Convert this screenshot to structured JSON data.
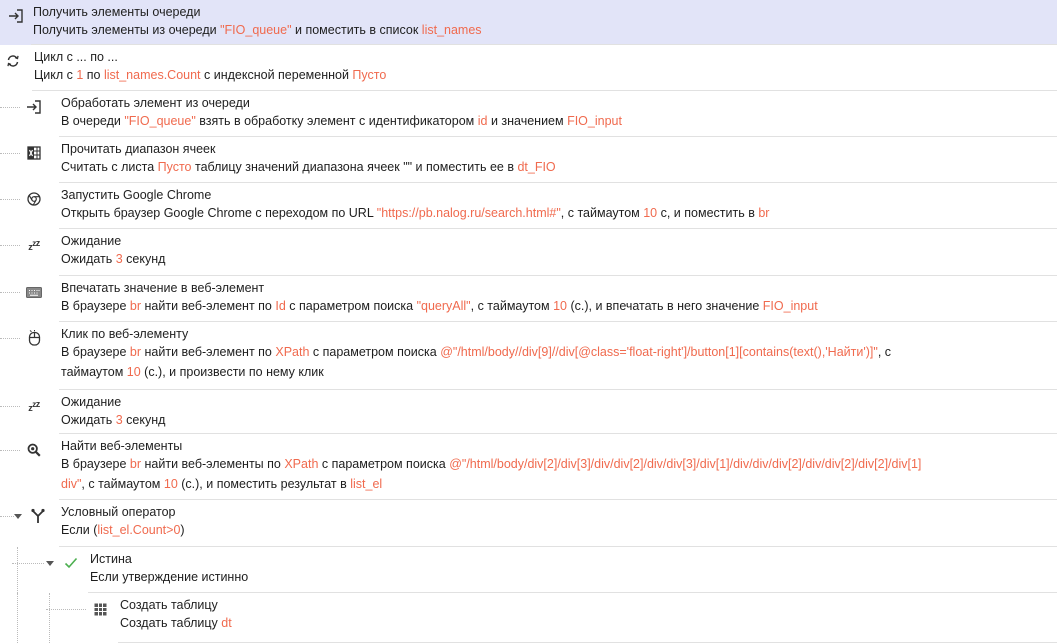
{
  "colors": {
    "accent_variable": "#f06a4e",
    "selected_row": "#e2e4f8",
    "text": "#1e1e1e"
  },
  "steps": [
    {
      "icon": "arrow-into-bracket-icon",
      "title": "Получить элементы очереди",
      "parts": [
        {
          "t": "Получить элементы из очереди "
        },
        {
          "t": "\"FIO_queue\"",
          "v": true
        },
        {
          "t": " и поместить в список "
        },
        {
          "t": "list_names",
          "v": true
        }
      ]
    },
    {
      "icon": "loop-arrows-icon",
      "title": "Цикл с ... по ...",
      "parts": [
        {
          "t": "Цикл с "
        },
        {
          "t": "1",
          "v": true
        },
        {
          "t": " по "
        },
        {
          "t": "list_names.Count",
          "v": true
        },
        {
          "t": " с индексной переменной "
        },
        {
          "t": "Пусто",
          "v": true
        }
      ]
    },
    {
      "icon": "arrow-into-bracket-icon",
      "title": "Обработать элемент из очереди",
      "parts": [
        {
          "t": "В очереди "
        },
        {
          "t": "\"FIO_queue\"",
          "v": true
        },
        {
          "t": " взять в обработку элемент с идентификатором "
        },
        {
          "t": "id",
          "v": true
        },
        {
          "t": " и значением "
        },
        {
          "t": "FIO_input",
          "v": true
        }
      ]
    },
    {
      "icon": "excel-sheet-icon",
      "title": "Прочитать диапазон ячеек",
      "parts": [
        {
          "t": "Считать с листа "
        },
        {
          "t": "Пусто",
          "v": true
        },
        {
          "t": " таблицу значений диапазона ячеек \"\" и поместить ее в "
        },
        {
          "t": "dt_FIO",
          "v": true
        }
      ]
    },
    {
      "icon": "chrome-logo-icon",
      "title": "Запустить Google Chrome",
      "parts": [
        {
          "t": "Открыть браузер Google Chrome с переходом по URL "
        },
        {
          "t": "\"https://pb.nalog.ru/search.html#\"",
          "v": true
        },
        {
          "t": ", с таймаутом "
        },
        {
          "t": "10",
          "v": true
        },
        {
          "t": " с, и поместить в "
        },
        {
          "t": "br",
          "v": true
        }
      ]
    },
    {
      "icon": "sleep-zzz-icon",
      "title": "Ожидание",
      "parts": [
        {
          "t": "Ожидать "
        },
        {
          "t": "3",
          "v": true
        },
        {
          "t": " секунд"
        }
      ]
    },
    {
      "icon": "keyboard-icon",
      "title": "Впечатать значение в веб-элемент",
      "parts": [
        {
          "t": "В браузере "
        },
        {
          "t": "br",
          "v": true
        },
        {
          "t": " найти веб-элемент по "
        },
        {
          "t": "Id",
          "v": true
        },
        {
          "t": " с параметром поиска "
        },
        {
          "t": "\"queryAll\"",
          "v": true
        },
        {
          "t": ", с таймаутом "
        },
        {
          "t": "10",
          "v": true
        },
        {
          "t": " (с.), и впечатать в него значение "
        },
        {
          "t": "FIO_input",
          "v": true
        }
      ]
    },
    {
      "icon": "mouse-click-icon",
      "title": "Клик по веб-элементу",
      "parts": [
        {
          "t": "В браузере "
        },
        {
          "t": "br",
          "v": true
        },
        {
          "t": " найти веб-элемент по "
        },
        {
          "t": "XPath",
          "v": true
        },
        {
          "t": " с параметром поиска "
        },
        {
          "t": "@\"/html/body//div[9]//div[@class='float-right']/button[1][contains(text(),'Найти')]\"",
          "v": true
        },
        {
          "t": ", с"
        }
      ],
      "parts2": [
        {
          "t": "таймаутом "
        },
        {
          "t": "10",
          "v": true
        },
        {
          "t": " (с.), и произвести по нему клик"
        }
      ]
    },
    {
      "icon": "sleep-zzz-icon",
      "title": "Ожидание",
      "parts": [
        {
          "t": "Ожидать "
        },
        {
          "t": "3",
          "v": true
        },
        {
          "t": " секунд"
        }
      ]
    },
    {
      "icon": "search-element-icon",
      "title": "Найти веб-элементы",
      "parts": [
        {
          "t": "В браузере "
        },
        {
          "t": "br",
          "v": true
        },
        {
          "t": " найти веб-элементы по "
        },
        {
          "t": "XPath",
          "v": true
        },
        {
          "t": " с параметром поиска "
        },
        {
          "t": "@\"/html/body/div[2]/div[3]/div/div[2]/div/div[3]/div[1]/div/div/div[2]/div/div[2]/div[2]/div[1]",
          "v": true
        }
      ],
      "parts2": [
        {
          "t": "div\"",
          "v": true
        },
        {
          "t": ", с таймаутом "
        },
        {
          "t": "10",
          "v": true
        },
        {
          "t": " (с.), и поместить результат в "
        },
        {
          "t": "list_el",
          "v": true
        }
      ]
    },
    {
      "icon": "branch-fork-icon",
      "title": "Условный оператор",
      "parts": [
        {
          "t": "Если ("
        },
        {
          "t": "list_el.Count>0",
          "v": true
        },
        {
          "t": ")"
        }
      ]
    },
    {
      "icon": "checkmark-icon",
      "title": "Истина",
      "parts": [
        {
          "t": "Если утверждение истинно"
        }
      ]
    },
    {
      "icon": "table-grid-icon",
      "title": "Создать таблицу",
      "parts": [
        {
          "t": "Создать таблицу "
        },
        {
          "t": "dt",
          "v": true
        }
      ]
    }
  ]
}
